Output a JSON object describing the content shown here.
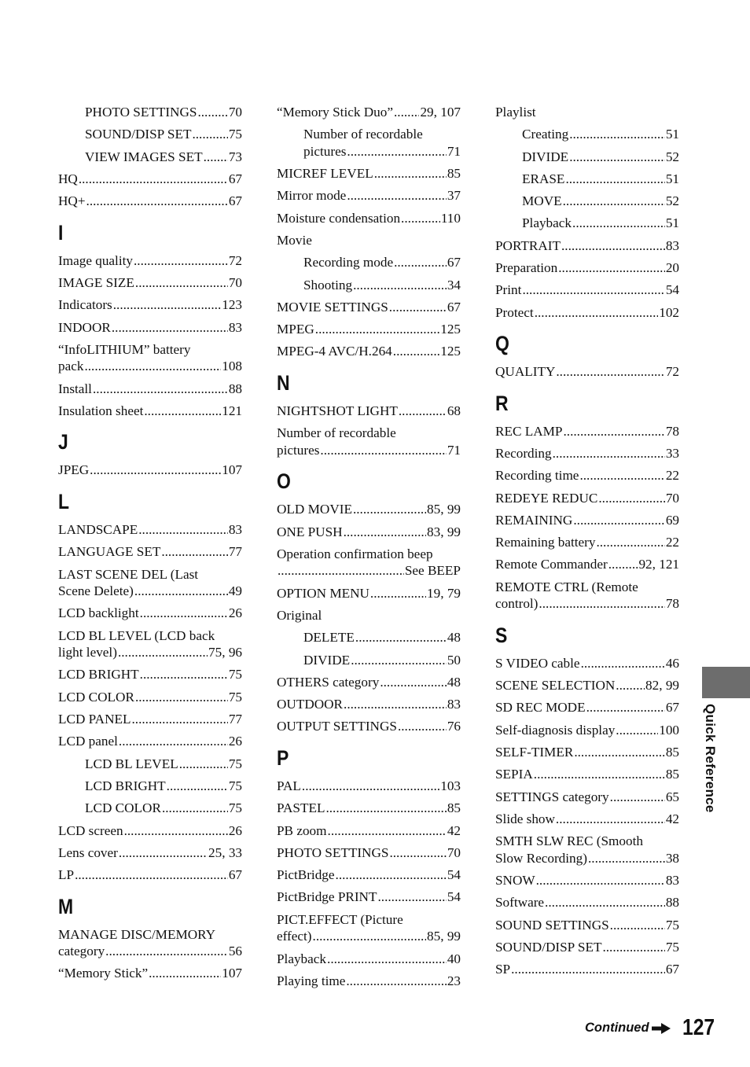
{
  "columns": [
    {
      "items": [
        {
          "type": "entry",
          "indent": true,
          "term": "PHOTO SETTINGS",
          "page": "70"
        },
        {
          "type": "entry",
          "indent": true,
          "term": "SOUND/DISP SET",
          "page": "75"
        },
        {
          "type": "entry",
          "indent": true,
          "term": "VIEW IMAGES SET",
          "page": "73"
        },
        {
          "type": "entry",
          "term": "HQ",
          "page": "67"
        },
        {
          "type": "entry",
          "term": "HQ+",
          "page": "67"
        },
        {
          "type": "letter",
          "text": "I"
        },
        {
          "type": "entry",
          "term": "Image quality",
          "page": "72"
        },
        {
          "type": "entry",
          "term": "IMAGE SIZE",
          "page": "70"
        },
        {
          "type": "entry",
          "term": "Indicators",
          "page": "123"
        },
        {
          "type": "entry",
          "term": "INDOOR",
          "page": "83"
        },
        {
          "type": "entry",
          "term": "“InfoLITHIUM” battery",
          "term2": "pack",
          "page": "108"
        },
        {
          "type": "entry",
          "term": "Install",
          "page": "88"
        },
        {
          "type": "entry",
          "term": "Insulation sheet",
          "page": "121"
        },
        {
          "type": "letter",
          "text": "J"
        },
        {
          "type": "entry",
          "term": "JPEG",
          "page": "107"
        },
        {
          "type": "letter",
          "text": "L"
        },
        {
          "type": "entry",
          "term": "LANDSCAPE",
          "page": "83"
        },
        {
          "type": "entry",
          "term": "LANGUAGE SET",
          "page": "77"
        },
        {
          "type": "entry",
          "term": "LAST SCENE DEL (Last",
          "term2": "Scene Delete)",
          "page": "49"
        },
        {
          "type": "entry",
          "term": "LCD backlight",
          "page": "26"
        },
        {
          "type": "entry",
          "term": "LCD BL LEVEL (LCD back",
          "term2": "light level)",
          "page": "75, 96"
        },
        {
          "type": "entry",
          "term": "LCD BRIGHT",
          "page": "75"
        },
        {
          "type": "entry",
          "term": "LCD COLOR",
          "page": "75"
        },
        {
          "type": "entry",
          "term": "LCD PANEL",
          "page": "77"
        },
        {
          "type": "entry",
          "term": "LCD panel",
          "page": "26"
        },
        {
          "type": "entry",
          "indent": true,
          "term": "LCD BL LEVEL",
          "page": "75"
        },
        {
          "type": "entry",
          "indent": true,
          "term": "LCD BRIGHT",
          "page": "75"
        },
        {
          "type": "entry",
          "indent": true,
          "term": "LCD COLOR",
          "page": "75"
        },
        {
          "type": "entry",
          "term": "LCD screen",
          "page": "26"
        },
        {
          "type": "entry",
          "term": "Lens cover",
          "page": "25, 33"
        },
        {
          "type": "entry",
          "term": "LP",
          "page": "67"
        },
        {
          "type": "letter",
          "text": "M"
        },
        {
          "type": "entry",
          "term": "MANAGE DISC/MEMORY",
          "term2": "category",
          "page": "56"
        },
        {
          "type": "entry",
          "term": "“Memory Stick”",
          "page": "107"
        }
      ]
    },
    {
      "items": [
        {
          "type": "entry",
          "term": "“Memory Stick Duo”",
          "page": "29, 107"
        },
        {
          "type": "entry",
          "indent": true,
          "term": "Number of recordable",
          "term2": "pictures",
          "page": "71"
        },
        {
          "type": "entry",
          "term": "MICREF LEVEL",
          "page": "85"
        },
        {
          "type": "entry",
          "term": "Mirror mode",
          "page": "37"
        },
        {
          "type": "entry",
          "term": "Moisture condensation",
          "page": "110"
        },
        {
          "type": "entry",
          "term": "Movie",
          "page": ""
        },
        {
          "type": "entry",
          "indent": true,
          "term": "Recording mode",
          "page": "67"
        },
        {
          "type": "entry",
          "indent": true,
          "term": "Shooting",
          "page": "34"
        },
        {
          "type": "entry",
          "term": "MOVIE SETTINGS",
          "page": "67"
        },
        {
          "type": "entry",
          "term": "MPEG",
          "page": "125"
        },
        {
          "type": "entry",
          "term": "MPEG-4 AVC/H.264",
          "page": "125"
        },
        {
          "type": "letter",
          "text": "N"
        },
        {
          "type": "entry",
          "term": "NIGHTSHOT LIGHT",
          "page": "68"
        },
        {
          "type": "entry",
          "term": "Number of recordable",
          "term2": "pictures",
          "page": "71"
        },
        {
          "type": "letter",
          "text": "O"
        },
        {
          "type": "entry",
          "term": "OLD MOVIE",
          "page": "85, 99"
        },
        {
          "type": "entry",
          "term": "ONE PUSH",
          "page": "83, 99"
        },
        {
          "type": "entry",
          "term": "Operation confirmation beep",
          "term2": "",
          "page": "See BEEP"
        },
        {
          "type": "entry",
          "term": "OPTION MENU",
          "page": "19, 79"
        },
        {
          "type": "entry",
          "term": "Original",
          "page": ""
        },
        {
          "type": "entry",
          "indent": true,
          "term": "DELETE",
          "page": "48"
        },
        {
          "type": "entry",
          "indent": true,
          "term": "DIVIDE",
          "page": "50"
        },
        {
          "type": "entry",
          "term": "OTHERS category",
          "page": "48"
        },
        {
          "type": "entry",
          "term": "OUTDOOR",
          "page": "83"
        },
        {
          "type": "entry",
          "term": "OUTPUT SETTINGS",
          "page": "76"
        },
        {
          "type": "letter",
          "text": "P"
        },
        {
          "type": "entry",
          "term": "PAL",
          "page": "103"
        },
        {
          "type": "entry",
          "term": "PASTEL",
          "page": "85"
        },
        {
          "type": "entry",
          "term": "PB zoom",
          "page": "42"
        },
        {
          "type": "entry",
          "term": "PHOTO SETTINGS",
          "page": "70"
        },
        {
          "type": "entry",
          "term": "PictBridge",
          "page": "54"
        },
        {
          "type": "entry",
          "term": "PictBridge PRINT",
          "page": "54"
        },
        {
          "type": "entry",
          "term": "PICT.EFFECT (Picture",
          "term2": "effect)",
          "page": "85, 99"
        },
        {
          "type": "entry",
          "term": "Playback",
          "page": "40"
        },
        {
          "type": "entry",
          "term": "Playing time",
          "page": "23"
        }
      ]
    },
    {
      "items": [
        {
          "type": "entry",
          "term": "Playlist",
          "page": ""
        },
        {
          "type": "entry",
          "indent": true,
          "term": "Creating",
          "page": "51"
        },
        {
          "type": "entry",
          "indent": true,
          "term": "DIVIDE",
          "page": "52"
        },
        {
          "type": "entry",
          "indent": true,
          "term": "ERASE",
          "page": "51"
        },
        {
          "type": "entry",
          "indent": true,
          "term": "MOVE",
          "page": "52"
        },
        {
          "type": "entry",
          "indent": true,
          "term": "Playback",
          "page": "51"
        },
        {
          "type": "entry",
          "term": "PORTRAIT",
          "page": "83"
        },
        {
          "type": "entry",
          "term": "Preparation",
          "page": "20"
        },
        {
          "type": "entry",
          "term": "Print",
          "page": "54"
        },
        {
          "type": "entry",
          "term": "Protect",
          "page": "102"
        },
        {
          "type": "letter",
          "text": "Q"
        },
        {
          "type": "entry",
          "term": "QUALITY",
          "page": "72"
        },
        {
          "type": "letter",
          "text": "R"
        },
        {
          "type": "entry",
          "term": "REC LAMP",
          "page": "78"
        },
        {
          "type": "entry",
          "term": "Recording",
          "page": "33"
        },
        {
          "type": "entry",
          "term": "Recording time",
          "page": "22"
        },
        {
          "type": "entry",
          "term": "REDEYE REDUC",
          "page": "70"
        },
        {
          "type": "entry",
          "term": "REMAINING",
          "page": "69"
        },
        {
          "type": "entry",
          "term": "Remaining battery",
          "page": "22"
        },
        {
          "type": "entry",
          "term": "Remote Commander",
          "page": "92, 121"
        },
        {
          "type": "entry",
          "term": "REMOTE CTRL (Remote",
          "term2": "control)",
          "page": "78"
        },
        {
          "type": "letter",
          "text": "S"
        },
        {
          "type": "entry",
          "term": "S VIDEO cable",
          "page": "46"
        },
        {
          "type": "entry",
          "term": "SCENE SELECTION",
          "page": "82, 99"
        },
        {
          "type": "entry",
          "term": "SD REC MODE",
          "page": "67"
        },
        {
          "type": "entry",
          "term": "Self-diagnosis display",
          "page": "100"
        },
        {
          "type": "entry",
          "term": "SELF-TIMER",
          "page": "85"
        },
        {
          "type": "entry",
          "term": "SEPIA",
          "page": "85"
        },
        {
          "type": "entry",
          "term": "SETTINGS category",
          "page": "65"
        },
        {
          "type": "entry",
          "term": "Slide show",
          "page": "42"
        },
        {
          "type": "entry",
          "term": "SMTH SLW REC (Smooth",
          "term2": "Slow Recording)",
          "page": "38"
        },
        {
          "type": "entry",
          "term": "SNOW",
          "page": "83"
        },
        {
          "type": "entry",
          "term": "Software",
          "page": "88"
        },
        {
          "type": "entry",
          "term": "SOUND SETTINGS",
          "page": "75"
        },
        {
          "type": "entry",
          "term": "SOUND/DISP SET",
          "page": "75"
        },
        {
          "type": "entry",
          "term": "SP",
          "page": "67"
        }
      ]
    }
  ],
  "side_tab": {
    "label": "Quick Reference",
    "color": "#6d6d6d"
  },
  "footer": {
    "continued_label": "Continued",
    "arrow_icon": "right-arrow-icon",
    "page_number": "127"
  }
}
